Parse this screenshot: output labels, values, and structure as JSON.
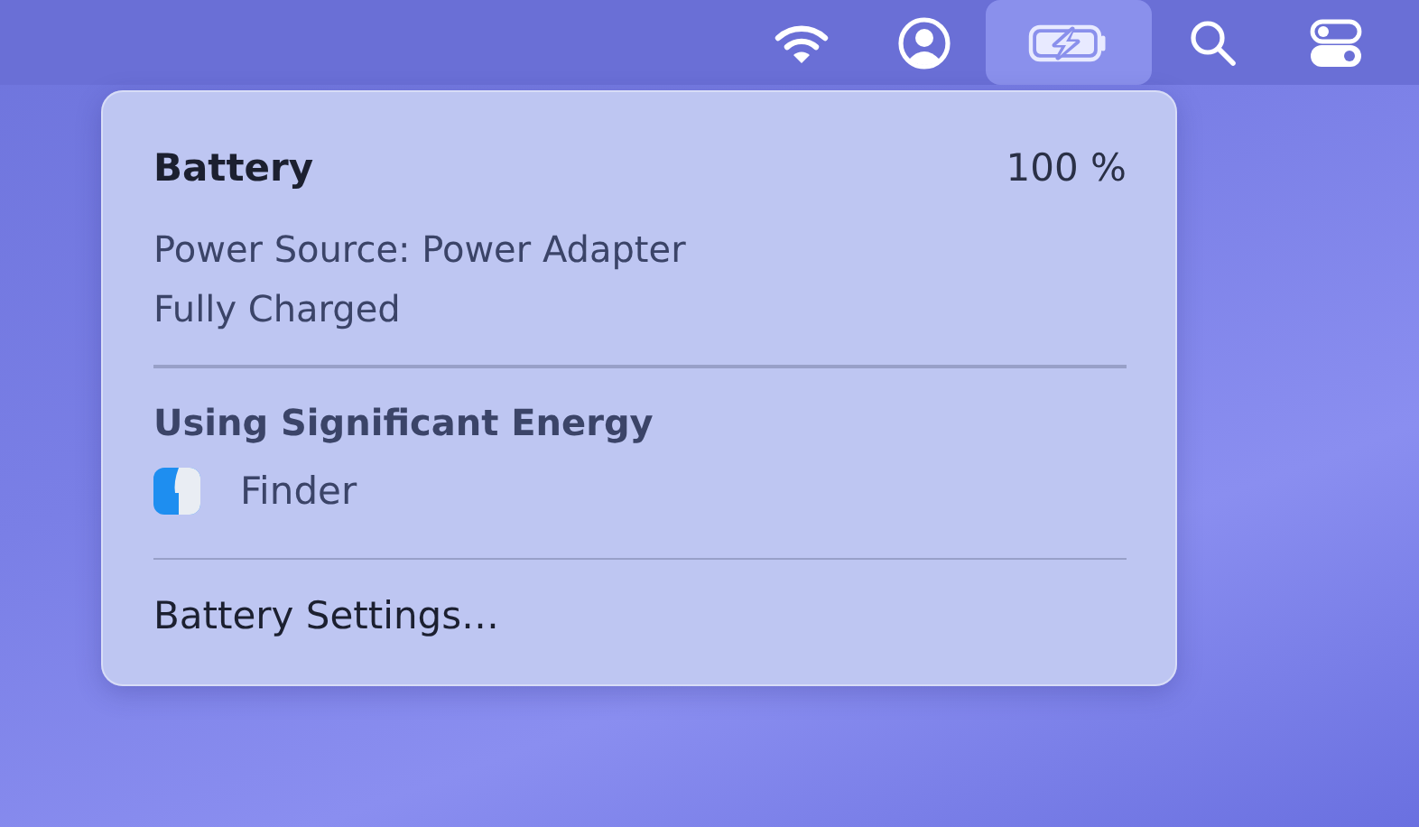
{
  "menu_bar": {
    "items": [
      {
        "kind": "wifi",
        "selected": false
      },
      {
        "kind": "user",
        "selected": false
      },
      {
        "kind": "battery",
        "selected": true
      },
      {
        "kind": "search",
        "selected": false
      },
      {
        "kind": "controls",
        "selected": false
      }
    ]
  },
  "battery_menu": {
    "title": "Battery",
    "percent": "100 %",
    "details": [
      "Power Source: Power Adapter",
      "Fully Charged"
    ],
    "section": "Using Significant Energy",
    "apps": [
      {
        "name": "Finder"
      }
    ],
    "action": "Battery Settings…"
  }
}
